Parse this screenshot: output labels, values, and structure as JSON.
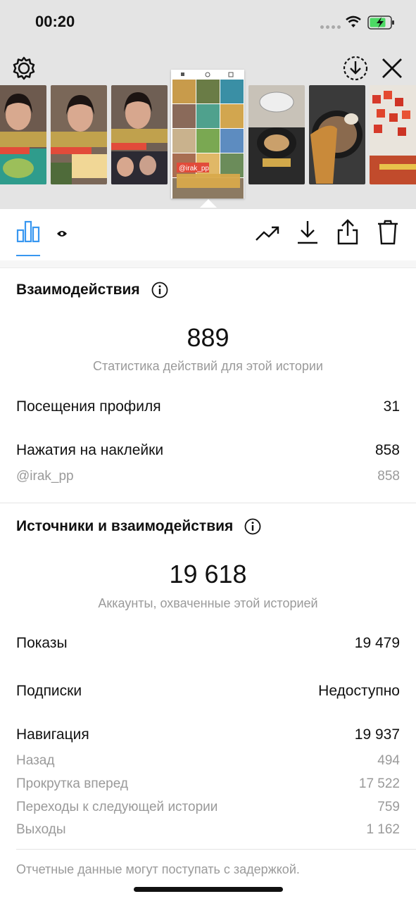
{
  "status_bar": {
    "time": "00:20"
  },
  "story_viewer": {
    "selected_sticker_text": "@irak_pp",
    "thumb_sticker_text": "@irak_pp"
  },
  "interactions": {
    "heading": "Взаимодействия",
    "total": "889",
    "total_caption": "Статистика действий для этой истории",
    "rows": [
      {
        "label": "Посещения профиля",
        "value": "31"
      },
      {
        "label": "Нажатия на наклейки",
        "value": "858"
      }
    ],
    "sticker_rows": [
      {
        "label": "@irak_pp",
        "value": "858"
      }
    ]
  },
  "discovery": {
    "heading": "Источники и взаимодействия",
    "total": "19 618",
    "total_caption": "Аккаунты, охваченные этой историей",
    "rows": [
      {
        "label": "Показы",
        "value": "19 479"
      },
      {
        "label": "Подписки",
        "value": "Недоступно"
      },
      {
        "label": "Навигация",
        "value": "19 937"
      }
    ],
    "navigation_rows": [
      {
        "label": "Назад",
        "value": "494"
      },
      {
        "label": "Прокрутка вперед",
        "value": "17 522"
      },
      {
        "label": "Переходы к следующей истории",
        "value": "759"
      },
      {
        "label": "Выходы",
        "value": "1 162"
      }
    ]
  },
  "footer": {
    "note": "Отчетные данные могут поступать с задержкой."
  },
  "colors": {
    "accent": "#3897f0",
    "muted": "#9a9a9a",
    "top_bg": "#e4e4e4"
  },
  "icons": [
    "gear-icon",
    "download-circle-icon",
    "close-icon",
    "bar-chart-icon",
    "eye-icon",
    "trending-icon",
    "download-icon",
    "share-icon",
    "trash-icon",
    "info-icon"
  ]
}
